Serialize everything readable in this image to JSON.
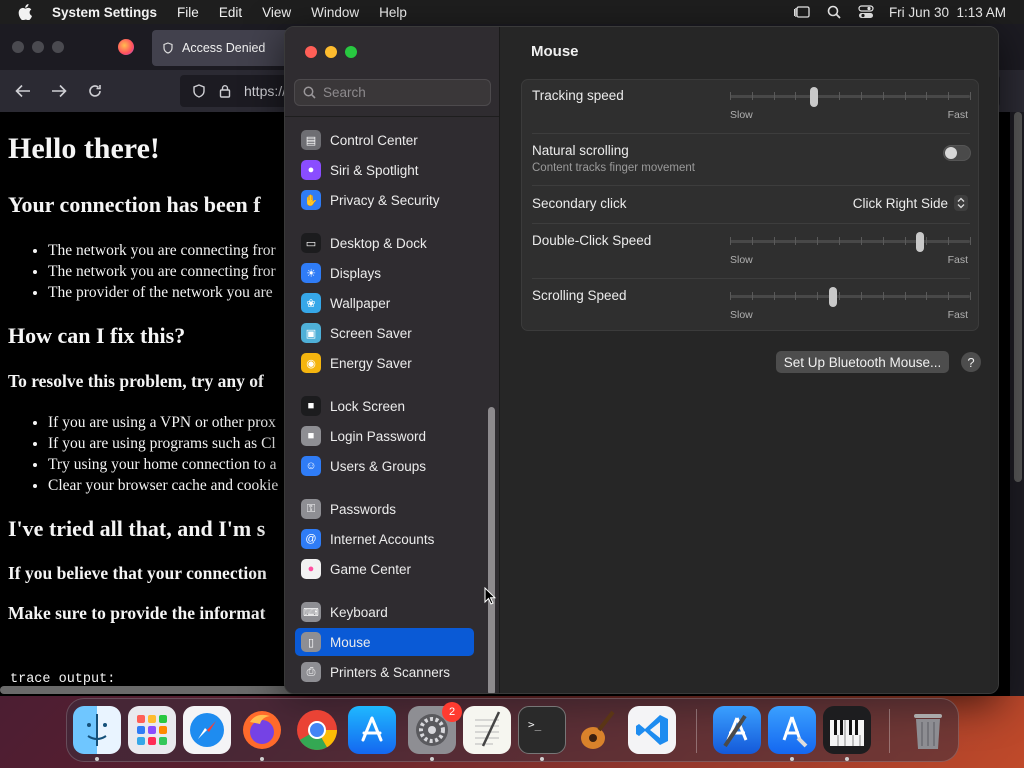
{
  "menubar": {
    "app_name": "System Settings",
    "menus": [
      "File",
      "Edit",
      "View",
      "Window",
      "Help"
    ],
    "datetime": "Fri Jun 30  1:13 AM"
  },
  "browser": {
    "tab_title": "Access Denied",
    "url_text": "https://",
    "page": {
      "h1": "Hello there!",
      "h2_connection": "Your connection has been f",
      "bullets1": [
        "The network you are connecting fror",
        "The network you are connecting fror",
        "The provider of the network you are"
      ],
      "h2_fix": "How can I fix this?",
      "h3_resolve": "To resolve this problem, try any of",
      "bullets2": [
        "If you are using a VPN or other prox",
        "If you are using programs such as Cl",
        "Try using your home connection to a",
        "Clear your browser cache and cookie"
      ],
      "h2_tried": "I've tried all that, and I'm s",
      "h3_believe": "If you believe that your connection",
      "h3_provide": "Make sure to provide the informat",
      "trace": "trace output:"
    }
  },
  "settings": {
    "search_placeholder": "Search",
    "sidebar": [
      {
        "label": "Control Center",
        "icon": "control-center-icon",
        "color": "#6e6e73"
      },
      {
        "label": "Siri & Spotlight",
        "icon": "siri-icon",
        "color": "#8a4dff"
      },
      {
        "label": "Privacy & Security",
        "icon": "hand-icon",
        "color": "#2f7cf6"
      },
      {
        "label": "Desktop & Dock",
        "icon": "desktop-dock-icon",
        "color": "#1c1c1e"
      },
      {
        "label": "Displays",
        "icon": "sun-icon",
        "color": "#2f7cf6"
      },
      {
        "label": "Wallpaper",
        "icon": "wallpaper-icon",
        "color": "#36a7e8"
      },
      {
        "label": "Screen Saver",
        "icon": "screen-saver-icon",
        "color": "#4fb0d8"
      },
      {
        "label": "Energy Saver",
        "icon": "bulb-icon",
        "color": "#f5b50f"
      },
      {
        "label": "Lock Screen",
        "icon": "lock-icon",
        "color": "#1c1c1e"
      },
      {
        "label": "Login Password",
        "icon": "lock-icon",
        "color": "#8e8e93"
      },
      {
        "label": "Users & Groups",
        "icon": "users-icon",
        "color": "#2f7cf6"
      },
      {
        "label": "Passwords",
        "icon": "key-icon",
        "color": "#8e8e93"
      },
      {
        "label": "Internet Accounts",
        "icon": "at-icon",
        "color": "#2f7cf6"
      },
      {
        "label": "Game Center",
        "icon": "game-center-icon",
        "color": "#f2f2f2"
      },
      {
        "label": "Keyboard",
        "icon": "keyboard-icon",
        "color": "#8e8e93"
      },
      {
        "label": "Mouse",
        "icon": "mouse-icon",
        "color": "#8e8e93"
      },
      {
        "label": "Printers & Scanners",
        "icon": "printer-icon",
        "color": "#8e8e93"
      }
    ],
    "selected": "Mouse",
    "content": {
      "title": "Mouse",
      "tracking_speed": {
        "label": "Tracking speed",
        "min": "Slow",
        "max": "Fast",
        "value": 0.35
      },
      "natural_scrolling": {
        "label": "Natural scrolling",
        "sub": "Content tracks finger movement",
        "on": false
      },
      "secondary_click": {
        "label": "Secondary click",
        "value": "Click Right Side"
      },
      "double_click": {
        "label": "Double-Click Speed",
        "min": "Slow",
        "max": "Fast",
        "value": 0.79
      },
      "scrolling_speed": {
        "label": "Scrolling Speed",
        "min": "Slow",
        "max": "Fast",
        "value": 0.43
      },
      "bt_button": "Set Up Bluetooth Mouse...",
      "help": "?"
    }
  },
  "dock": {
    "badge": "2",
    "apps": [
      "finder-icon",
      "launchpad-icon",
      "safari-icon",
      "firefox-icon",
      "chrome-icon",
      "app-store-icon",
      "system-settings-icon",
      "textedit-icon",
      "terminal-icon",
      "garageband-icon",
      "vscode-icon",
      "xcode-icon",
      "simulator-icon",
      "piano-icon",
      "trash-icon"
    ]
  }
}
